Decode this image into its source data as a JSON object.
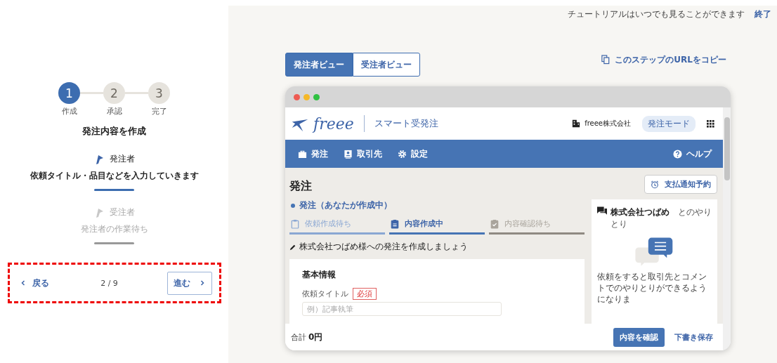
{
  "tutorial": {
    "hint": "チュートリアルはいつでも見ることができます",
    "end": "終了"
  },
  "steps": [
    {
      "number": "1",
      "label": "作成",
      "selected": true
    },
    {
      "number": "2",
      "label": "承認",
      "selected": false
    },
    {
      "number": "3",
      "label": "完了",
      "selected": false
    }
  ],
  "step_title": "発注内容を作成",
  "roles": [
    {
      "name": "発注者",
      "description": "依頼タイトル・品目などを入力していきます",
      "active": true
    },
    {
      "name": "受注者",
      "description": "発注者の作業待ち",
      "active": false
    }
  ],
  "pager": {
    "back": "戻る",
    "position": "2 / 9",
    "next": "進む"
  },
  "view_tabs": [
    {
      "label": "発注者ビュー",
      "selected": true
    },
    {
      "label": "受注者ビュー",
      "selected": false
    }
  ],
  "copy_link": "このステップのURLをコピー",
  "app": {
    "logo": "freee",
    "product": "スマート受発注",
    "company": "freee株式会社",
    "mode": "発注モード",
    "nav": [
      {
        "label": "発注"
      },
      {
        "label": "取引先"
      },
      {
        "label": "設定"
      }
    ],
    "help": "ヘルプ",
    "page_title": "発注",
    "schedule_button": "支払通知予約",
    "status": "発注（あなたが作成中）",
    "progress": [
      {
        "label": "依頼作成待ち",
        "kind": "done"
      },
      {
        "label": "内容作成中",
        "kind": "current"
      },
      {
        "label": "内容確認待ち",
        "kind": "todo"
      }
    ],
    "instruction": "株式会社つばめ様への発注を作成しましょう",
    "section_title": "基本情報",
    "field_label": "依頼タイトル",
    "required_badge": "必須",
    "field_placeholder": "例）記事執筆",
    "chat": {
      "partner": "株式会社つばめ",
      "suffix": "とのやりとり",
      "message": "依頼をすると取引先とコメントでのやりとりができるようになりま"
    },
    "total_label": "合計",
    "total": "0円",
    "confirm_button": "内容を確認",
    "draft_button": "下書き保存"
  }
}
